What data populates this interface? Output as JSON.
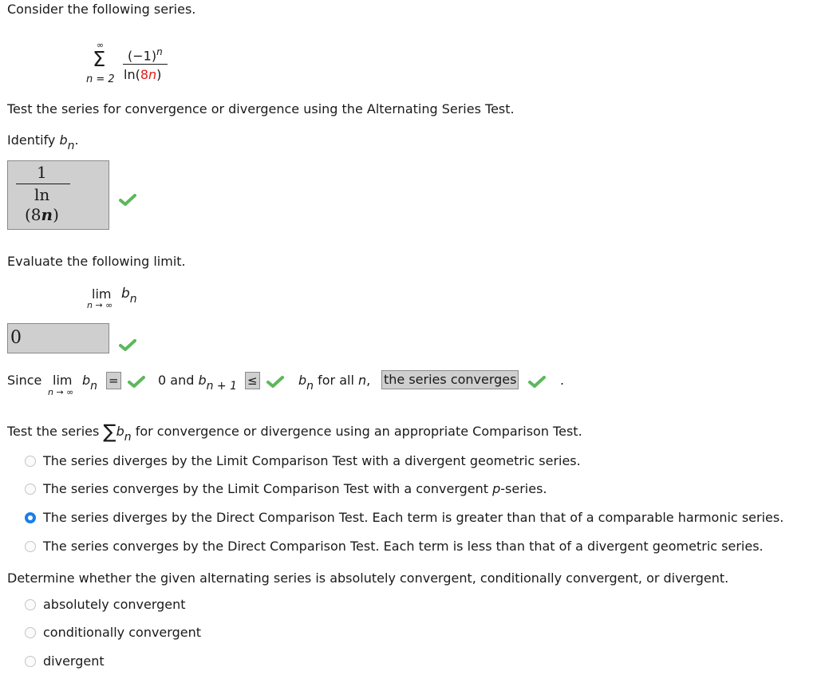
{
  "intro": "Consider the following series.",
  "series": {
    "sum_upper": "∞",
    "sum_lower": "n = 2",
    "numerator_base": "(−1)",
    "numerator_exp": "n",
    "denominator_prefix": "ln(",
    "denominator_highlight": "8",
    "denominator_var": "n",
    "denominator_suffix": ")"
  },
  "instruction": "Test the series for convergence or divergence using the Alternating Series Test.",
  "identify": {
    "label": "Identify ",
    "var": "b",
    "sub": "n",
    "period": ".",
    "answer": {
      "numerator": "1",
      "den_line1": "ln",
      "den_line2_open": "(8",
      "den_line2_var": "n",
      "den_line2_close": ")"
    },
    "status": "correct"
  },
  "limit": {
    "label": "Evaluate the following limit.",
    "lim": "lim",
    "lim_sub": "n → ∞",
    "var": "b",
    "sub": "n",
    "answer": "0",
    "status": "correct"
  },
  "since": {
    "word": "Since",
    "lim": "lim",
    "lim_sub": "n → ∞",
    "var": "b",
    "sub": "n",
    "select1": "=",
    "mid_text": "0 and ",
    "var2": "b",
    "sub2": "n + 1",
    "select2": "≤",
    "var3": "b",
    "sub3": "n",
    "for_all": " for all ",
    "n": "n",
    "comma": ",",
    "select3": "the series converges",
    "period": "."
  },
  "comparison": {
    "prefix": "Test the series ",
    "sigma": "∑",
    "var": "b",
    "sub": "n",
    "suffix": " for convergence or divergence using an appropriate Comparison Test.",
    "options": [
      {
        "text": "The series diverges by the Limit Comparison Test with a divergent geometric series.",
        "checked": false
      },
      {
        "text_pre": "The series converges by the Limit Comparison Test with a convergent ",
        "text_it": "p",
        "text_post": "-series.",
        "checked": false
      },
      {
        "text": "The series diverges by the Direct Comparison Test. Each term is greater than that of a comparable harmonic series.",
        "checked": true
      },
      {
        "text": "The series converges by the Direct Comparison Test. Each term is less than that of a divergent geometric series.",
        "checked": false
      }
    ]
  },
  "classification": {
    "question": "Determine whether the given alternating series is absolutely convergent, conditionally convergent, or divergent.",
    "options": [
      {
        "text": "absolutely convergent",
        "checked": false
      },
      {
        "text": "conditionally convergent",
        "checked": false
      },
      {
        "text": "divergent",
        "checked": false
      }
    ]
  },
  "colors": {
    "check_green": "#5cb85c",
    "radio_selected": "#1a7fe8",
    "highlight_red": "#e0201b",
    "answer_box_bg": "#cfcfcf"
  }
}
